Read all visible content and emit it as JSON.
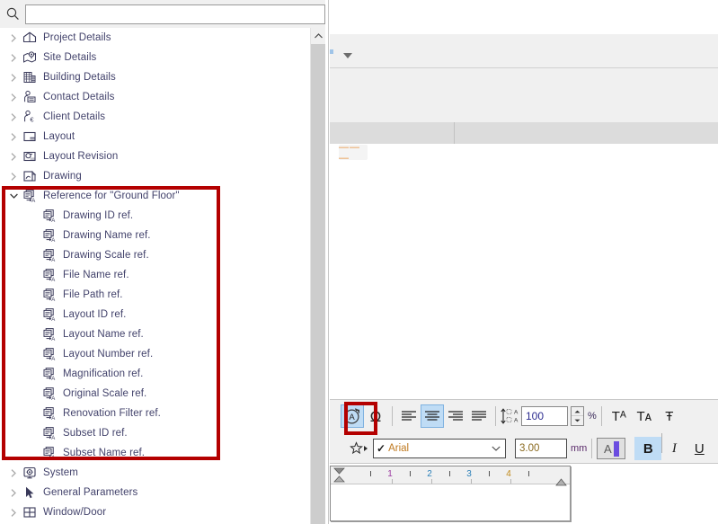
{
  "search": {
    "placeholder": "",
    "value": "",
    "icon": "search-icon"
  },
  "tree": {
    "items": [
      {
        "label": "Project Details",
        "level": 0,
        "expanded": false,
        "icon": "house-icon",
        "highlighted": false
      },
      {
        "label": "Site Details",
        "level": 0,
        "expanded": false,
        "icon": "map-pin-icon",
        "highlighted": false
      },
      {
        "label": "Building Details",
        "level": 0,
        "expanded": false,
        "icon": "building-icon",
        "highlighted": false
      },
      {
        "label": "Contact Details",
        "level": 0,
        "expanded": false,
        "icon": "contact-card-icon",
        "highlighted": false
      },
      {
        "label": "Client Details",
        "level": 0,
        "expanded": false,
        "icon": "client-euro-icon",
        "highlighted": false
      },
      {
        "label": "Layout",
        "level": 0,
        "expanded": false,
        "icon": "layout-icon",
        "highlighted": false
      },
      {
        "label": "Layout Revision",
        "level": 0,
        "expanded": false,
        "icon": "layout-revision-icon",
        "highlighted": false
      },
      {
        "label": "Drawing",
        "level": 0,
        "expanded": false,
        "icon": "drawing-icon",
        "highlighted": false
      },
      {
        "label": "Reference for \"Ground Floor\"",
        "level": 0,
        "expanded": true,
        "icon": "reference-a-icon",
        "highlighted": true
      },
      {
        "label": "Drawing ID ref.",
        "level": 1,
        "expanded": null,
        "icon": "reference-a-icon",
        "highlighted": true
      },
      {
        "label": "Drawing Name ref.",
        "level": 1,
        "expanded": null,
        "icon": "reference-a-icon",
        "highlighted": true
      },
      {
        "label": "Drawing Scale ref.",
        "level": 1,
        "expanded": null,
        "icon": "reference-a-icon",
        "highlighted": true
      },
      {
        "label": "File Name ref.",
        "level": 1,
        "expanded": null,
        "icon": "reference-a-icon",
        "highlighted": true
      },
      {
        "label": "File Path ref.",
        "level": 1,
        "expanded": null,
        "icon": "reference-a-icon",
        "highlighted": true
      },
      {
        "label": "Layout ID ref.",
        "level": 1,
        "expanded": null,
        "icon": "reference-a-icon",
        "highlighted": true
      },
      {
        "label": "Layout Name ref.",
        "level": 1,
        "expanded": null,
        "icon": "reference-a-icon",
        "highlighted": true
      },
      {
        "label": "Layout Number ref.",
        "level": 1,
        "expanded": null,
        "icon": "reference-a-icon",
        "highlighted": true
      },
      {
        "label": "Magnification ref.",
        "level": 1,
        "expanded": null,
        "icon": "reference-a-icon",
        "highlighted": true
      },
      {
        "label": "Original Scale ref.",
        "level": 1,
        "expanded": null,
        "icon": "reference-a-icon",
        "highlighted": true
      },
      {
        "label": "Renovation Filter ref.",
        "level": 1,
        "expanded": null,
        "icon": "reference-a-icon",
        "highlighted": true
      },
      {
        "label": "Subset ID ref.",
        "level": 1,
        "expanded": null,
        "icon": "reference-a-icon",
        "highlighted": true
      },
      {
        "label": "Subset Name ref.",
        "level": 1,
        "expanded": null,
        "icon": "reference-a-icon",
        "highlighted": true
      },
      {
        "label": "System",
        "level": 0,
        "expanded": false,
        "icon": "system-gear-icon",
        "highlighted": false
      },
      {
        "label": "General Parameters",
        "level": 0,
        "expanded": false,
        "icon": "arrow-cursor-icon",
        "highlighted": false
      },
      {
        "label": "Window/Door",
        "level": 0,
        "expanded": false,
        "icon": "window-door-icon",
        "highlighted": false
      }
    ],
    "collapsed_glyph": "›",
    "expanded_glyph": "⌄"
  },
  "highlight": {
    "color": "#b40000",
    "selection_label": "reference-parameters-group"
  },
  "toolbar": {
    "row1": {
      "rotate_text_label": "A",
      "rotate_text_name": "text-rotate-tool",
      "special_char_label": "Ω",
      "align_left_label": "align-left",
      "align_center_label": "align-center",
      "align_right_label": "align-right",
      "align_justify_label": "align-justify",
      "line_spacing_label": "line-spacing",
      "line_spacing_value": "100",
      "line_spacing_unit": "%",
      "superscript_label": "Tᴬ",
      "subscript_label": "Tᴀ",
      "strikethrough_label": "Ŧ"
    },
    "row2": {
      "favorites_label": "favorites",
      "font_name": "Arial",
      "font_check": "✓",
      "font_size": "3.00",
      "font_size_unit": "mm",
      "color_label": "A",
      "color_swatch": "#6a4ce0",
      "bold_label": "B",
      "italic_label": "I",
      "underline_label": "U"
    },
    "active_buttons": [
      "text-rotate-tool",
      "align-center",
      "bold"
    ]
  },
  "ruler": {
    "numbers": [
      "1",
      "2",
      "3",
      "4"
    ],
    "number_colors": [
      "#9b3aa0",
      "#2a7fb8",
      "#2a7fb8",
      "#c08a1a"
    ],
    "text_value": ""
  },
  "right_panel": {
    "dash_preview": "— — —",
    "dash_color": "#e8903a",
    "caret_label": "dropdown-caret"
  }
}
